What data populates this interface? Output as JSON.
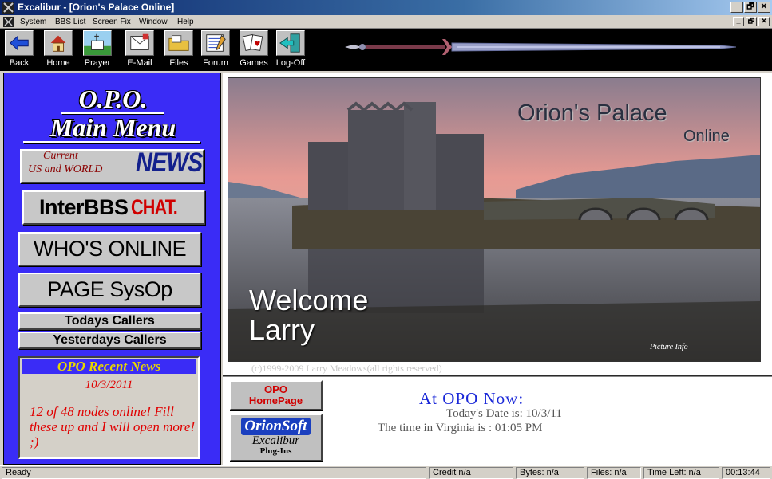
{
  "window": {
    "title": "Excalibur - [Orion's Palace Online]",
    "controls": [
      "_",
      "🗗",
      "✕"
    ]
  },
  "menubar": {
    "items": [
      "System",
      "BBS List",
      "Screen Fix",
      "Window",
      "Help"
    ]
  },
  "toolbar": {
    "buttons": [
      {
        "label": "Back",
        "icon": "back-arrow-icon"
      },
      {
        "label": "Home",
        "icon": "home-icon"
      },
      {
        "label": "Prayer",
        "icon": "church-icon"
      },
      {
        "label": "E-Mail",
        "icon": "email-icon"
      },
      {
        "label": "Files",
        "icon": "folder-icon"
      },
      {
        "label": "Forum",
        "icon": "forum-icon"
      },
      {
        "label": "Games",
        "icon": "cards-icon"
      },
      {
        "label": "Log-Off",
        "icon": "exit-door-icon"
      }
    ]
  },
  "left_menu": {
    "title_line1": "O.P.O.",
    "title_line2": "Main Menu",
    "news_button": {
      "line1": "Current",
      "line2": "US and WORLD",
      "big": "NEWS"
    },
    "chat_button": {
      "part1": "InterBBS",
      "part2": "CHAT."
    },
    "whos_online": "WHO'S ONLINE",
    "page_sysop": "PAGE SysOp",
    "todays_callers": "Todays Callers",
    "yesterdays_callers": "Yesterdays Callers",
    "recent_news": {
      "heading": "OPO Recent News",
      "date": "10/3/2011",
      "body": "12 of 48 nodes online! Fill these up and I will open more! ;)"
    }
  },
  "main": {
    "picture_title": "Orion's Palace",
    "picture_subtitle": "Online",
    "welcome": "Welcome",
    "user_name": "Larry",
    "picture_info": "Picture Info",
    "copyright": "(c)1999-2009 Larry Meadows(all rights reserved)",
    "opo_homepage": {
      "line1": "OPO",
      "line2": "HomePage"
    },
    "orionsoft": {
      "line1": "OrionSoft",
      "line2": "Excalibur",
      "line3": "Plug-Ins"
    },
    "now_title": "At OPO Now:",
    "date_line": "Today's Date is: 10/3/11",
    "time_line": "The time in Virginia is : 01:05 PM"
  },
  "statusbar": {
    "status": "Ready",
    "credit": "Credit n/a",
    "bytes": "Bytes: n/a",
    "files": "Files: n/a",
    "time_left": "Time Left: n/a",
    "clock": "00:13:44"
  },
  "colors": {
    "menu_panel": "#3a2cf6",
    "title_gradient_start": "#0a246a",
    "now_title": "#1a28d8",
    "news_red": "#e00000"
  }
}
